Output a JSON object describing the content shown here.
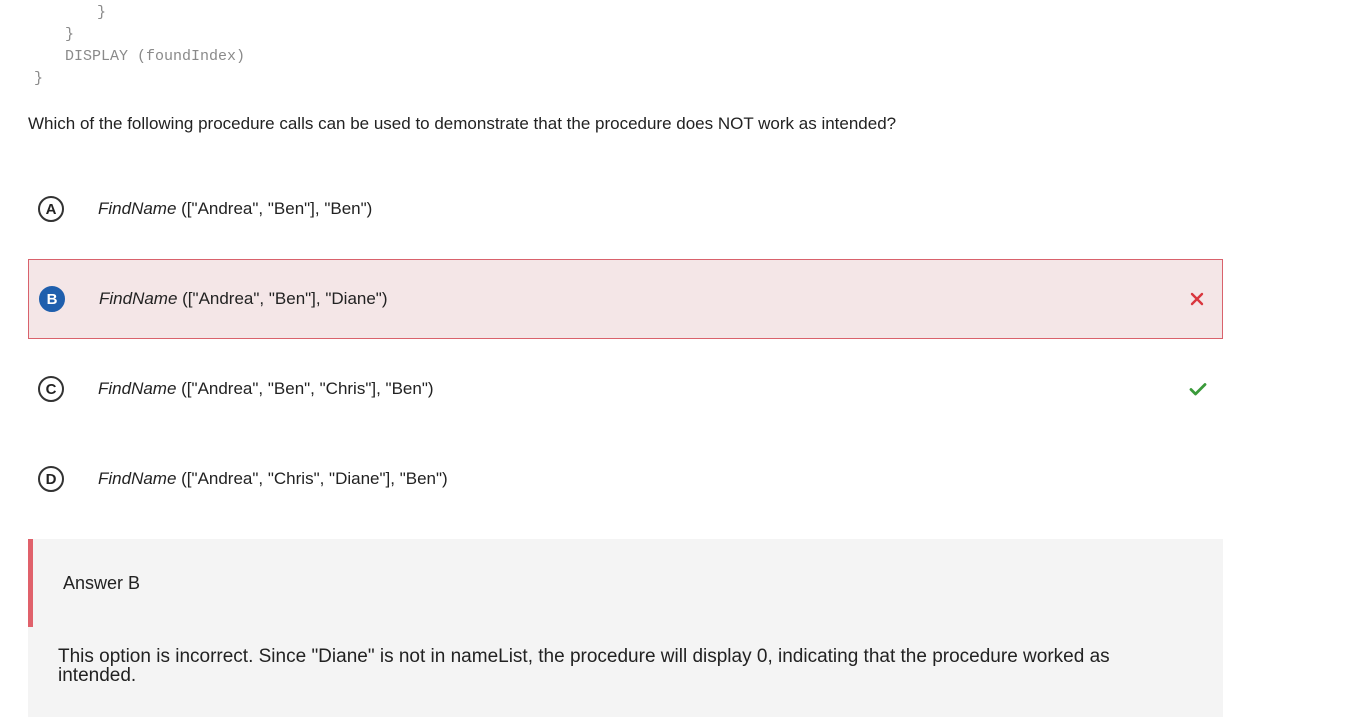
{
  "code": {
    "lines": [
      "}",
      "}",
      "DISPLAY (foundIndex)",
      "}"
    ]
  },
  "question": {
    "text": "Which of the following procedure calls can be used to demonstrate that the procedure does NOT work as intended?"
  },
  "choices": [
    {
      "letter": "A",
      "fn": "FindName",
      "args": " ([\"Andrea\", \"Ben\"], \"Ben\")",
      "state": "none"
    },
    {
      "letter": "B",
      "fn": "FindName",
      "args": " ([\"Andrea\", \"Ben\"], \"Diane\")",
      "state": "selected-incorrect"
    },
    {
      "letter": "C",
      "fn": "FindName",
      "args": " ([\"Andrea\", \"Ben\", \"Chris\"], \"Ben\")",
      "state": "correct"
    },
    {
      "letter": "D",
      "fn": "FindName",
      "args": " ([\"Andrea\", \"Chris\", \"Diane\"], \"Ben\")",
      "state": "none"
    }
  ],
  "icons": {
    "incorrect": "close-icon",
    "correct": "check-icon"
  },
  "colors": {
    "incorrect": "#d9363e",
    "correct": "#3a9a3a",
    "selected": "#1f5fad"
  },
  "answer": {
    "title": "Answer B",
    "explanation": "This option is incorrect. Since \"Diane\" is not in nameList, the procedure will display 0, indicating that the procedure worked as intended."
  }
}
